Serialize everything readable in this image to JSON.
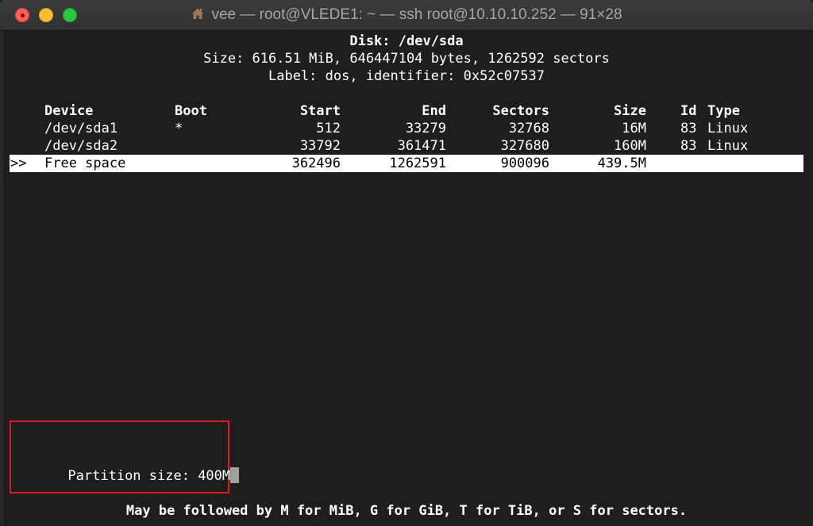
{
  "window": {
    "title": "vee — root@VLEDE1: ~ — ssh root@10.10.10.252 — 91×28"
  },
  "disk": {
    "name": "Disk: /dev/sda",
    "size": "Size: 616.51 MiB, 646447104 bytes, 1262592 sectors",
    "label": "Label: dos, identifier: 0x52c07537"
  },
  "table": {
    "headers": {
      "device": "Device",
      "boot": "Boot",
      "start": "Start",
      "end": "End",
      "sectors": "Sectors",
      "size": "Size",
      "id": "Id",
      "type": "Type"
    },
    "rows": [
      {
        "marker": "",
        "device": "/dev/sda1",
        "boot": "*",
        "start": "512",
        "end": "33279",
        "sectors": "32768",
        "size": "16M",
        "id": "83",
        "type": "Linux"
      },
      {
        "marker": "",
        "device": "/dev/sda2",
        "boot": "",
        "start": "33792",
        "end": "361471",
        "sectors": "327680",
        "size": "160M",
        "id": "83",
        "type": "Linux"
      },
      {
        "marker": ">>",
        "device": "Free space",
        "boot": "",
        "start": "362496",
        "end": "1262591",
        "sectors": "900096",
        "size": "439.5M",
        "id": "",
        "type": ""
      }
    ]
  },
  "prompt": {
    "label": "Partition size: ",
    "value": "400M"
  },
  "hint": "May be followed by M for MiB, G for GiB, T for TiB, or S for sectors.",
  "colors": {
    "background": "#1e1e1e",
    "highlight_box": "#e0191f",
    "selection": "#ffffff"
  }
}
